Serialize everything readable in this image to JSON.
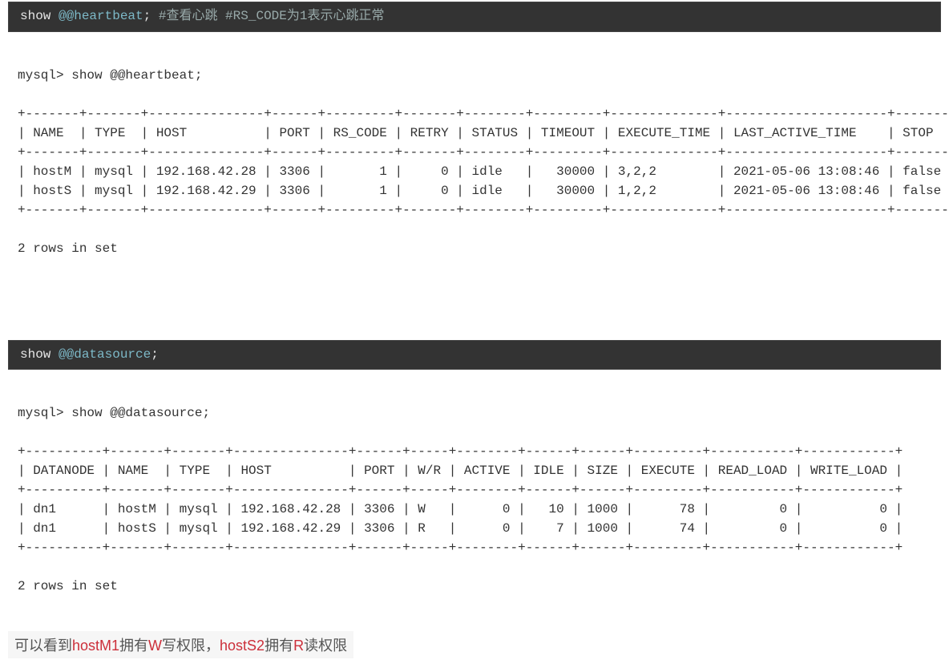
{
  "chart_data": {
    "type": "table",
    "tables": [
      {
        "command": "show @@heartbeat",
        "columns": [
          "NAME",
          "TYPE",
          "HOST",
          "PORT",
          "RS_CODE",
          "RETRY",
          "STATUS",
          "TIMEOUT",
          "EXECUTE_TIME",
          "LAST_ACTIVE_TIME",
          "STOP"
        ],
        "rows": [
          {
            "NAME": "hostM",
            "TYPE": "mysql",
            "HOST": "192.168.42.28",
            "PORT": 3306,
            "RS_CODE": 1,
            "RETRY": 0,
            "STATUS": "idle",
            "TIMEOUT": 30000,
            "EXECUTE_TIME": "3,2,2",
            "LAST_ACTIVE_TIME": "2021-05-06 13:08:46",
            "STOP": "false"
          },
          {
            "NAME": "hostS",
            "TYPE": "mysql",
            "HOST": "192.168.42.29",
            "PORT": 3306,
            "RS_CODE": 1,
            "RETRY": 0,
            "STATUS": "idle",
            "TIMEOUT": 30000,
            "EXECUTE_TIME": "1,2,2",
            "LAST_ACTIVE_TIME": "2021-05-06 13:08:46",
            "STOP": "false"
          }
        ],
        "rows_in_set": 2
      },
      {
        "command": "show @@datasource",
        "columns": [
          "DATANODE",
          "NAME",
          "TYPE",
          "HOST",
          "PORT",
          "W/R",
          "ACTIVE",
          "IDLE",
          "SIZE",
          "EXECUTE",
          "READ_LOAD",
          "WRITE_LOAD"
        ],
        "rows": [
          {
            "DATANODE": "dn1",
            "NAME": "hostM",
            "TYPE": "mysql",
            "HOST": "192.168.42.28",
            "PORT": 3306,
            "W/R": "W",
            "ACTIVE": 0,
            "IDLE": 10,
            "SIZE": 1000,
            "EXECUTE": 78,
            "READ_LOAD": 0,
            "WRITE_LOAD": 0
          },
          {
            "DATANODE": "dn1",
            "NAME": "hostS",
            "TYPE": "mysql",
            "HOST": "192.168.42.29",
            "PORT": 3306,
            "W/R": "R",
            "ACTIVE": 0,
            "IDLE": 7,
            "SIZE": 1000,
            "EXECUTE": 74,
            "READ_LOAD": 0,
            "WRITE_LOAD": 0
          }
        ],
        "rows_in_set": 2
      }
    ]
  },
  "block1": {
    "cmd_show": "show",
    "cmd_at": "@@heartbeat",
    "cmd_semi": ";",
    "cmd_comment": " #查看心跳 #RS_CODE为1表示心跳正常",
    "prompt": "mysql> show @@heartbeat;",
    "footer": "2 rows in set"
  },
  "block2": {
    "cmd_show": "show",
    "cmd_at": "@@datasource",
    "cmd_semi": ";",
    "prompt": "mysql> show @@datasource;",
    "footer": "2 rows in set"
  },
  "callout": {
    "t1": "可以看到",
    "r1": "hostM1",
    "t2": "拥有",
    "r2": "W",
    "t3": "写权限，",
    "r3": "hostS2",
    "t4": "拥有",
    "r4": "R",
    "t5": "读权限"
  }
}
